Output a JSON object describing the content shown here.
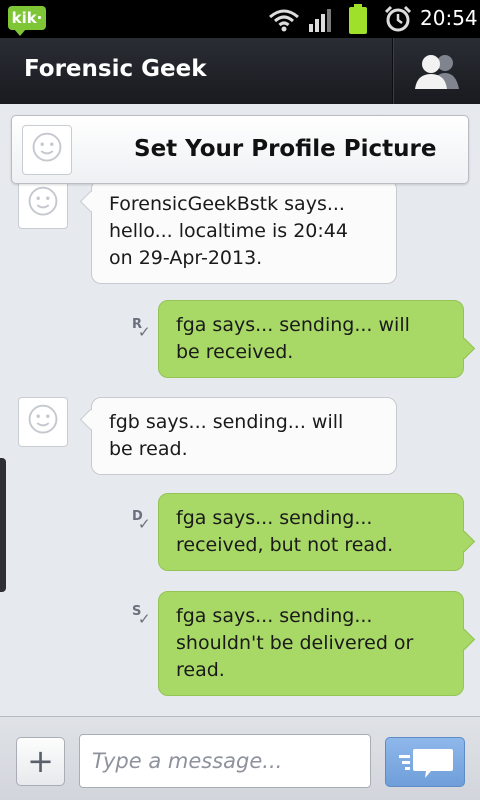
{
  "status_bar": {
    "app_badge": "kik·",
    "time": "20:54",
    "icons": [
      "kik-icon",
      "wifi-icon",
      "signal-icon",
      "battery-icon",
      "alarm-icon"
    ]
  },
  "header": {
    "title": "Forensic Geek",
    "contacts_icon": "contacts-icon"
  },
  "profile_banner": {
    "label": "Set Your Profile Picture"
  },
  "messages": [
    {
      "direction": "in",
      "text": "ForensicGeekBstk says...\nhello... localtime is 20:44\non 29-Apr-2013."
    },
    {
      "direction": "out",
      "receipt": "R",
      "text": "fga says... sending... will\nbe received."
    },
    {
      "direction": "in",
      "text": "fgb says... sending... will\nbe read."
    },
    {
      "direction": "out",
      "receipt": "D",
      "text": "fga says... sending...\nreceived, but not read."
    },
    {
      "direction": "out",
      "receipt": "S",
      "text": "fga says... sending...\nshouldn't be delivered or\nread."
    }
  ],
  "composer": {
    "add_label": "+",
    "placeholder": "Type a message...",
    "value": "",
    "send_icon": "send-icon"
  },
  "colors": {
    "incoming_bubble": "#fbfbfc",
    "outgoing_bubble": "#a8d866",
    "header_bg": "#1f2127",
    "send_button": "#7ba8e0"
  }
}
